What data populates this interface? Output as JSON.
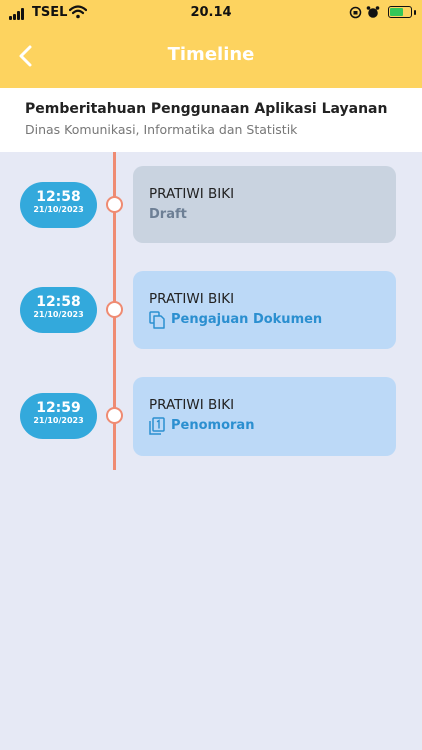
{
  "status_bar": {
    "carrier": "TSEL",
    "time": "20.14"
  },
  "header": {
    "title": "Timeline"
  },
  "info": {
    "title": "Pemberitahuan Penggunaan Aplikasi Layanan",
    "subtitle": "Dinas Komunikasi, Informatika dan Statistik"
  },
  "timeline": [
    {
      "time": "12:58",
      "date": "21/10/2023",
      "name": "PRATIWI BIKI",
      "status": "Draft",
      "icon": "none"
    },
    {
      "time": "12:58",
      "date": "21/10/2023",
      "name": "PRATIWI BIKI",
      "status": "Pengajuan Dokumen",
      "icon": "copy-document-icon"
    },
    {
      "time": "12:59",
      "date": "21/10/2023",
      "name": "PRATIWI BIKI",
      "status": "Penomoran",
      "icon": "numbered-document-icon"
    }
  ]
}
